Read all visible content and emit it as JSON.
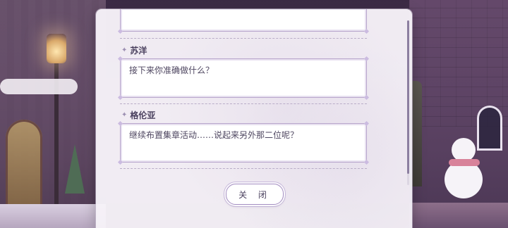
{
  "dialog_log": {
    "entries": [
      {
        "speaker": "",
        "text": ""
      },
      {
        "speaker": "苏洋",
        "text": "接下来你准确做什么？"
      },
      {
        "speaker": "格伦亚",
        "text": "继续布置集章活动……说起来另外那二位呢？"
      }
    ],
    "close_label": "关 闭"
  },
  "icons": {
    "speaker_marker": "sparkle-icon"
  },
  "colors": {
    "panel_bg": "#f6f2f8",
    "accent_border": "#b8a6cc",
    "text": "#4e4660"
  }
}
